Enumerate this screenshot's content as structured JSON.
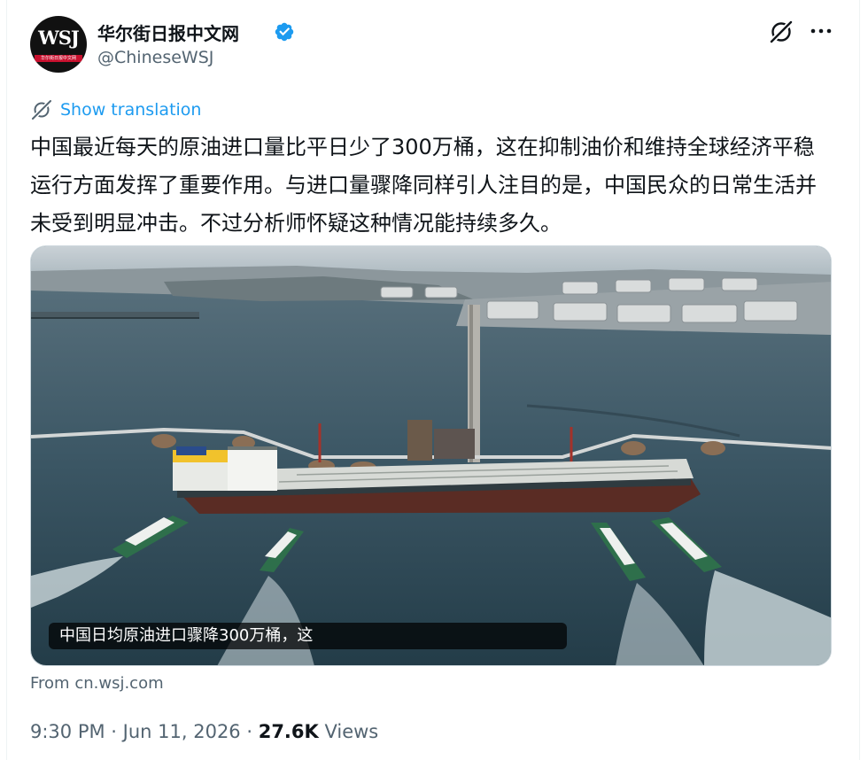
{
  "author": {
    "name": "华尔街日报中文网",
    "handle": "@ChineseWSJ",
    "avatar_text": "WSJ",
    "avatar_subtext": "华尔街日报中文网",
    "verified_icon": "verified-badge-icon"
  },
  "actions": {
    "grok_icon": "grok-icon",
    "more_icon": "more-options-icon"
  },
  "translation": {
    "label": "Show translation",
    "icon": "translate-icon"
  },
  "tweet": {
    "text": "中国最近每天的原油进口量比平日少了300万桶，这在抑制油价和维持全球经济平稳运行方面发挥了重要作用。与进口量骤降同样引人注目的是，中国民众的日常生活并未受到明显冲击。不过分析师怀疑这种情况能持续多久。"
  },
  "media": {
    "caption": "中国日均原油进口骤降300万桶，这",
    "source": "From cn.wsj.com"
  },
  "meta": {
    "time": "9:30 PM",
    "separator1": " · ",
    "date": "Jun 11, 2026",
    "separator2": " · ",
    "views_count": "27.6K",
    "views_label": " Views"
  },
  "colors": {
    "accent": "#1d9bf0",
    "text": "#0f1419",
    "secondary": "#536471"
  }
}
